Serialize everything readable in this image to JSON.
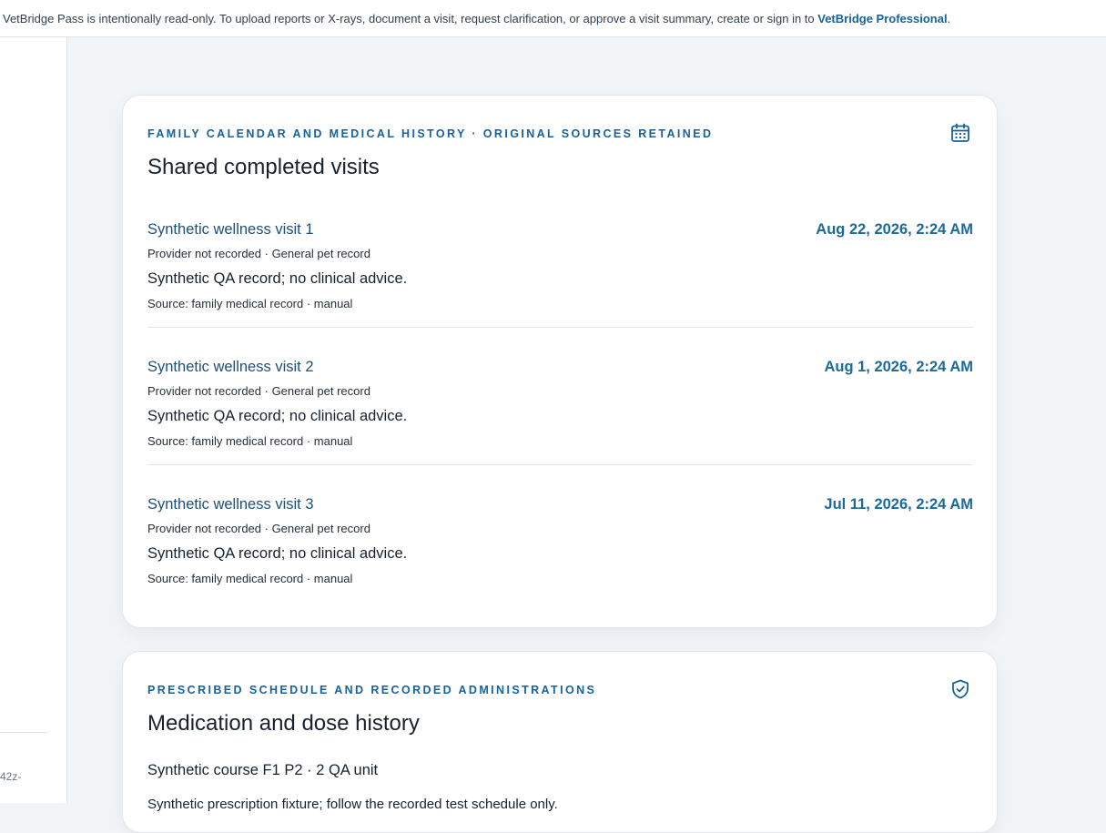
{
  "banner": {
    "text": "VetBridge Pass is intentionally read-only. To upload reports or X-rays, document a visit, request clarification, or approve a visit summary, create or sign in to ",
    "link_label": "VetBridge Professional",
    "suffix": "."
  },
  "sidebar": {
    "fragment": "42z-"
  },
  "visits_card": {
    "eyebrow": "FAMILY CALENDAR AND MEDICAL HISTORY · ORIGINAL SOURCES RETAINED",
    "title": "Shared completed visits",
    "icon": "calendar-icon",
    "visits": [
      {
        "title": "Synthetic wellness visit 1",
        "datetime": "Aug 22, 2026, 2:24 AM",
        "meta": "Provider not recorded · General pet record",
        "note": "Synthetic QA record; no clinical advice.",
        "source": "Source: family medical record · manual"
      },
      {
        "title": "Synthetic wellness visit 2",
        "datetime": "Aug 1, 2026, 2:24 AM",
        "meta": "Provider not recorded · General pet record",
        "note": "Synthetic QA record; no clinical advice.",
        "source": "Source: family medical record · manual"
      },
      {
        "title": "Synthetic wellness visit 3",
        "datetime": "Jul 11, 2026, 2:24 AM",
        "meta": "Provider not recorded · General pet record",
        "note": "Synthetic QA record; no clinical advice.",
        "source": "Source: family medical record · manual"
      }
    ]
  },
  "medication_card": {
    "eyebrow": "PRESCRIBED SCHEDULE AND RECORDED ADMINISTRATIONS",
    "title": "Medication and dose history",
    "icon": "shield-check-icon",
    "course": "Synthetic course F1 P2 · 2 QA unit",
    "prescription": "Synthetic prescription fixture; follow the recorded test schedule only."
  },
  "colors": {
    "accent": "#17629a",
    "background": "#f2f5f8",
    "card": "#ffffff"
  }
}
